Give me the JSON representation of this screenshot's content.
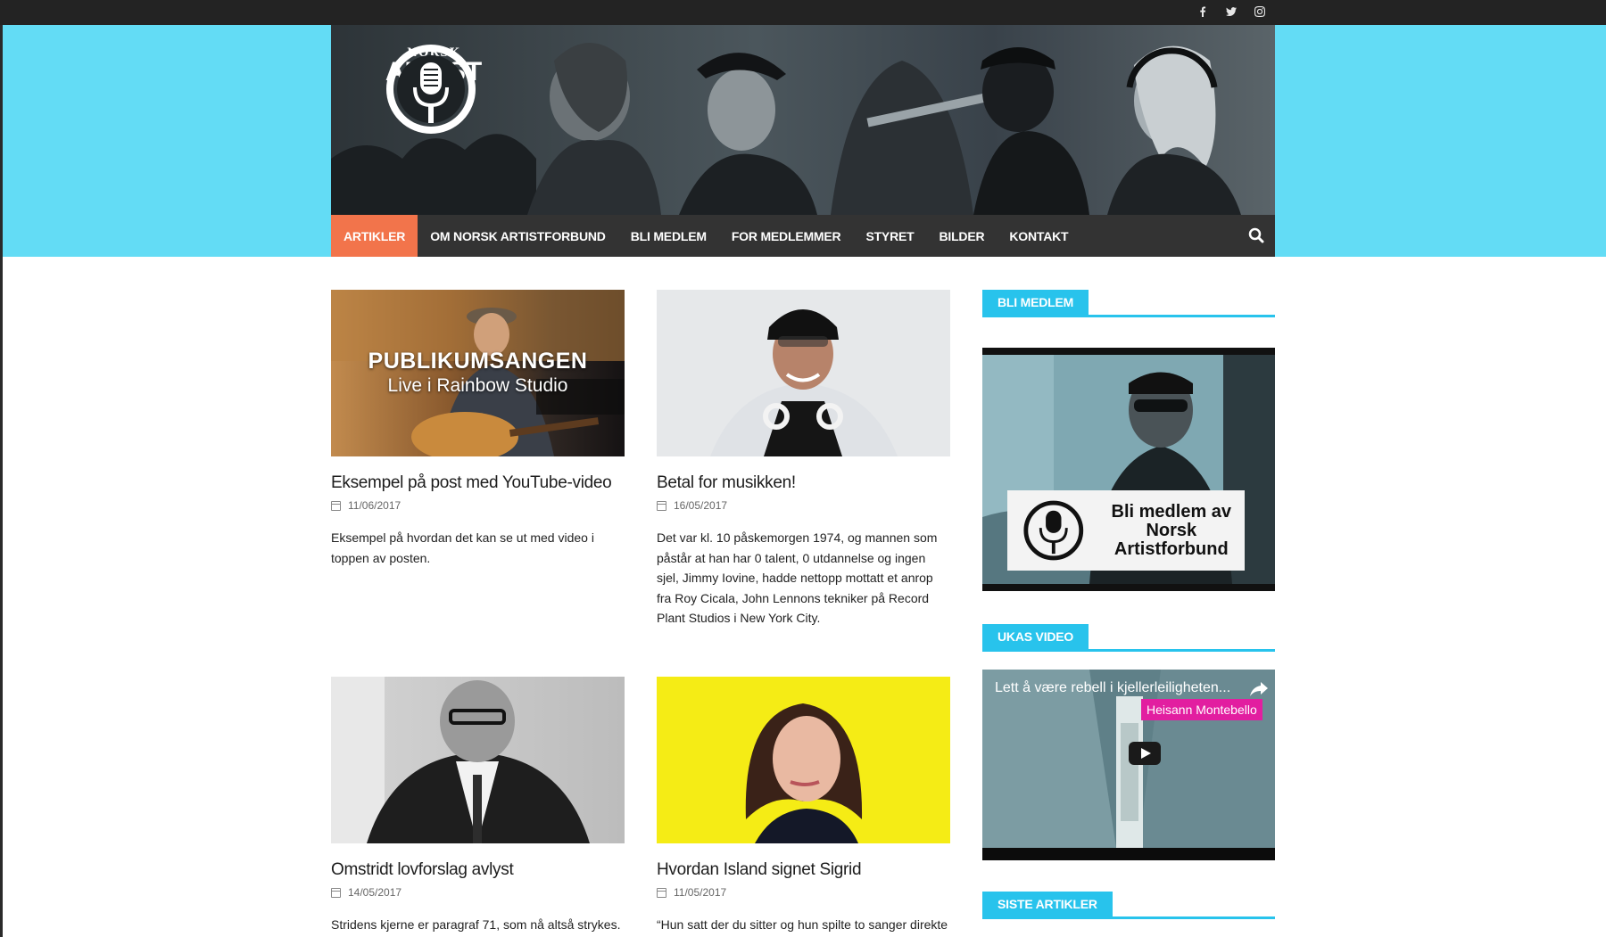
{
  "topbar": {
    "social": [
      {
        "icon": "facebook-icon",
        "glyph": "f"
      },
      {
        "icon": "twitter-icon",
        "glyph": "t"
      },
      {
        "icon": "instagram-icon",
        "glyph": "i"
      }
    ]
  },
  "colors": {
    "accent_cyan": "#28c3ec",
    "header_bg": "#63dcf5",
    "nav_active": "#f2744b",
    "nav_bg": "#333333",
    "topbar_bg": "#232323",
    "video_channel_pink": "#e21ea0"
  },
  "logo": {
    "norsk": "NORSK",
    "artist": "ARTIST",
    "forbund": "FORBUND"
  },
  "nav": {
    "items": [
      {
        "label": "ARTIKLER",
        "active": true
      },
      {
        "label": "OM NORSK ARTISTFORBUND",
        "active": false
      },
      {
        "label": "BLI MEDLEM",
        "active": false
      },
      {
        "label": "FOR MEDLEMMER",
        "active": false
      },
      {
        "label": "STYRET",
        "active": false
      },
      {
        "label": "BILDER",
        "active": false
      },
      {
        "label": "KONTAKT",
        "active": false
      }
    ],
    "search_icon": "search-icon"
  },
  "posts": [
    {
      "image_overlay_title": "PUBLIKUMSANGEN",
      "image_overlay_subtitle": "Live i Rainbow Studio",
      "title": "Eksempel på post med YouTube-video",
      "date": "11/06/2017",
      "excerpt": "Eksempel på hvordan det kan se ut med video i toppen av posten."
    },
    {
      "title": "Betal for musikken!",
      "date": "16/05/2017",
      "excerpt": "Det var kl. 10 påskemorgen 1974, og mannen som påstår at han har 0 talent, 0 utdannelse og ingen sjel, Jimmy Iovine, hadde nettopp mottatt et anrop fra Roy Cicala, John Lennons tekniker på Record Plant Studios i New York City."
    },
    {
      "title": "Omstridt lovforslag avlyst",
      "date": "14/05/2017",
      "excerpt": "Stridens kjerne er paragraf 71, som nå altså strykes."
    },
    {
      "title": "Hvordan Island signet Sigrid",
      "date": "11/05/2017",
      "excerpt": "“Hun satt der du sitter og hun spilte to sanger direkte"
    }
  ],
  "sidebar": {
    "join_heading": "BLI MEDLEM",
    "join_card_text": "Bli medlem av Norsk Artistforbund",
    "video_heading": "UKAS VIDEO",
    "video_title": "Lett å være rebell i kjellerleiligheten...",
    "video_channel": "Heisann Montebello",
    "recent_heading": "SISTE ARTIKLER"
  }
}
